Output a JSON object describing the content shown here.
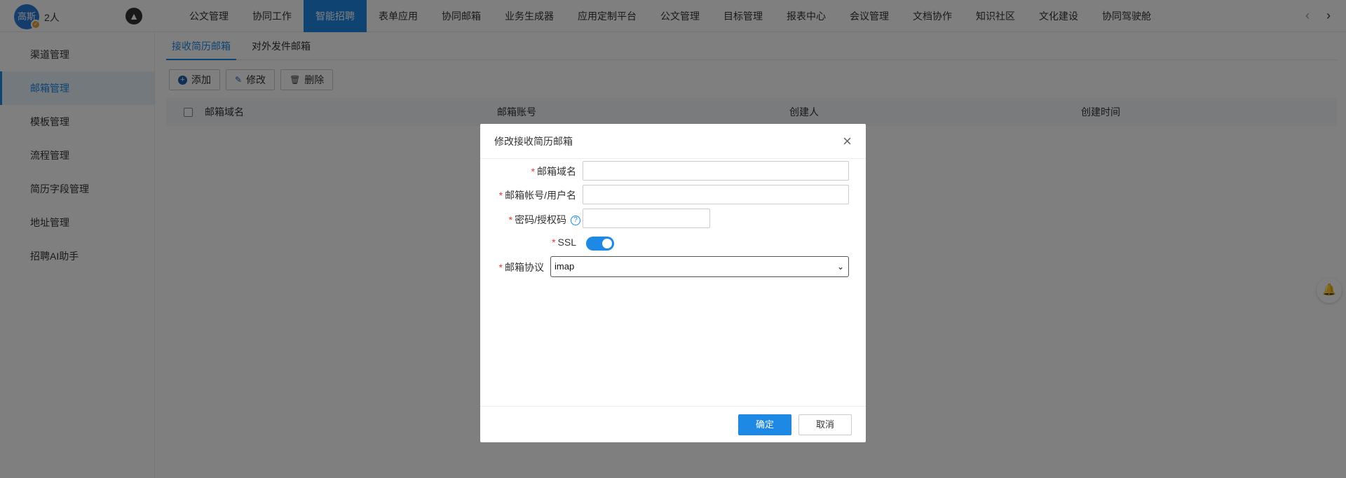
{
  "header": {
    "avatar_text": "高斯",
    "online_count": "2人",
    "logo_icon": "compass-icon",
    "nav": [
      {
        "label": "公文管理",
        "active": false
      },
      {
        "label": "协同工作",
        "active": false
      },
      {
        "label": "智能招聘",
        "active": true
      },
      {
        "label": "表单应用",
        "active": false
      },
      {
        "label": "协同邮箱",
        "active": false
      },
      {
        "label": "业务生成器",
        "active": false
      },
      {
        "label": "应用定制平台",
        "active": false
      },
      {
        "label": "公文管理",
        "active": false
      },
      {
        "label": "目标管理",
        "active": false
      },
      {
        "label": "报表中心",
        "active": false
      },
      {
        "label": "会议管理",
        "active": false
      },
      {
        "label": "文档协作",
        "active": false
      },
      {
        "label": "知识社区",
        "active": false
      },
      {
        "label": "文化建设",
        "active": false
      },
      {
        "label": "协同驾驶舱",
        "active": false
      }
    ],
    "prev_icon": "chevron-left-icon",
    "next_icon": "chevron-right-icon"
  },
  "sidebar": {
    "items": [
      {
        "label": "渠道管理",
        "active": false
      },
      {
        "label": "邮箱管理",
        "active": true
      },
      {
        "label": "模板管理",
        "active": false
      },
      {
        "label": "流程管理",
        "active": false
      },
      {
        "label": "简历字段管理",
        "active": false
      },
      {
        "label": "地址管理",
        "active": false
      },
      {
        "label": "招聘AI助手",
        "active": false
      }
    ]
  },
  "main": {
    "tabs": [
      {
        "label": "接收简历邮箱",
        "active": true
      },
      {
        "label": "对外发件邮箱",
        "active": false
      }
    ],
    "toolbar": {
      "add_label": "添加",
      "edit_label": "修改",
      "delete_label": "删除"
    },
    "table": {
      "columns": [
        "邮箱域名",
        "邮箱账号",
        "创建人",
        "创建时间"
      ]
    }
  },
  "modal": {
    "title": "修改接收简历邮箱",
    "fields": {
      "domain_label": "邮箱域名",
      "domain_value": "",
      "account_label": "邮箱帐号/用户名",
      "account_value": "",
      "password_label": "密码/授权码",
      "password_value": "",
      "help_icon": "question-circle-icon",
      "ssl_label": "SSL",
      "ssl_on": true,
      "protocol_label": "邮箱协议",
      "protocol_value": "imap"
    },
    "required_mark": "*",
    "confirm_label": "确定",
    "cancel_label": "取消"
  },
  "colors": {
    "primary": "#1e88e5",
    "required": "#e53935"
  }
}
